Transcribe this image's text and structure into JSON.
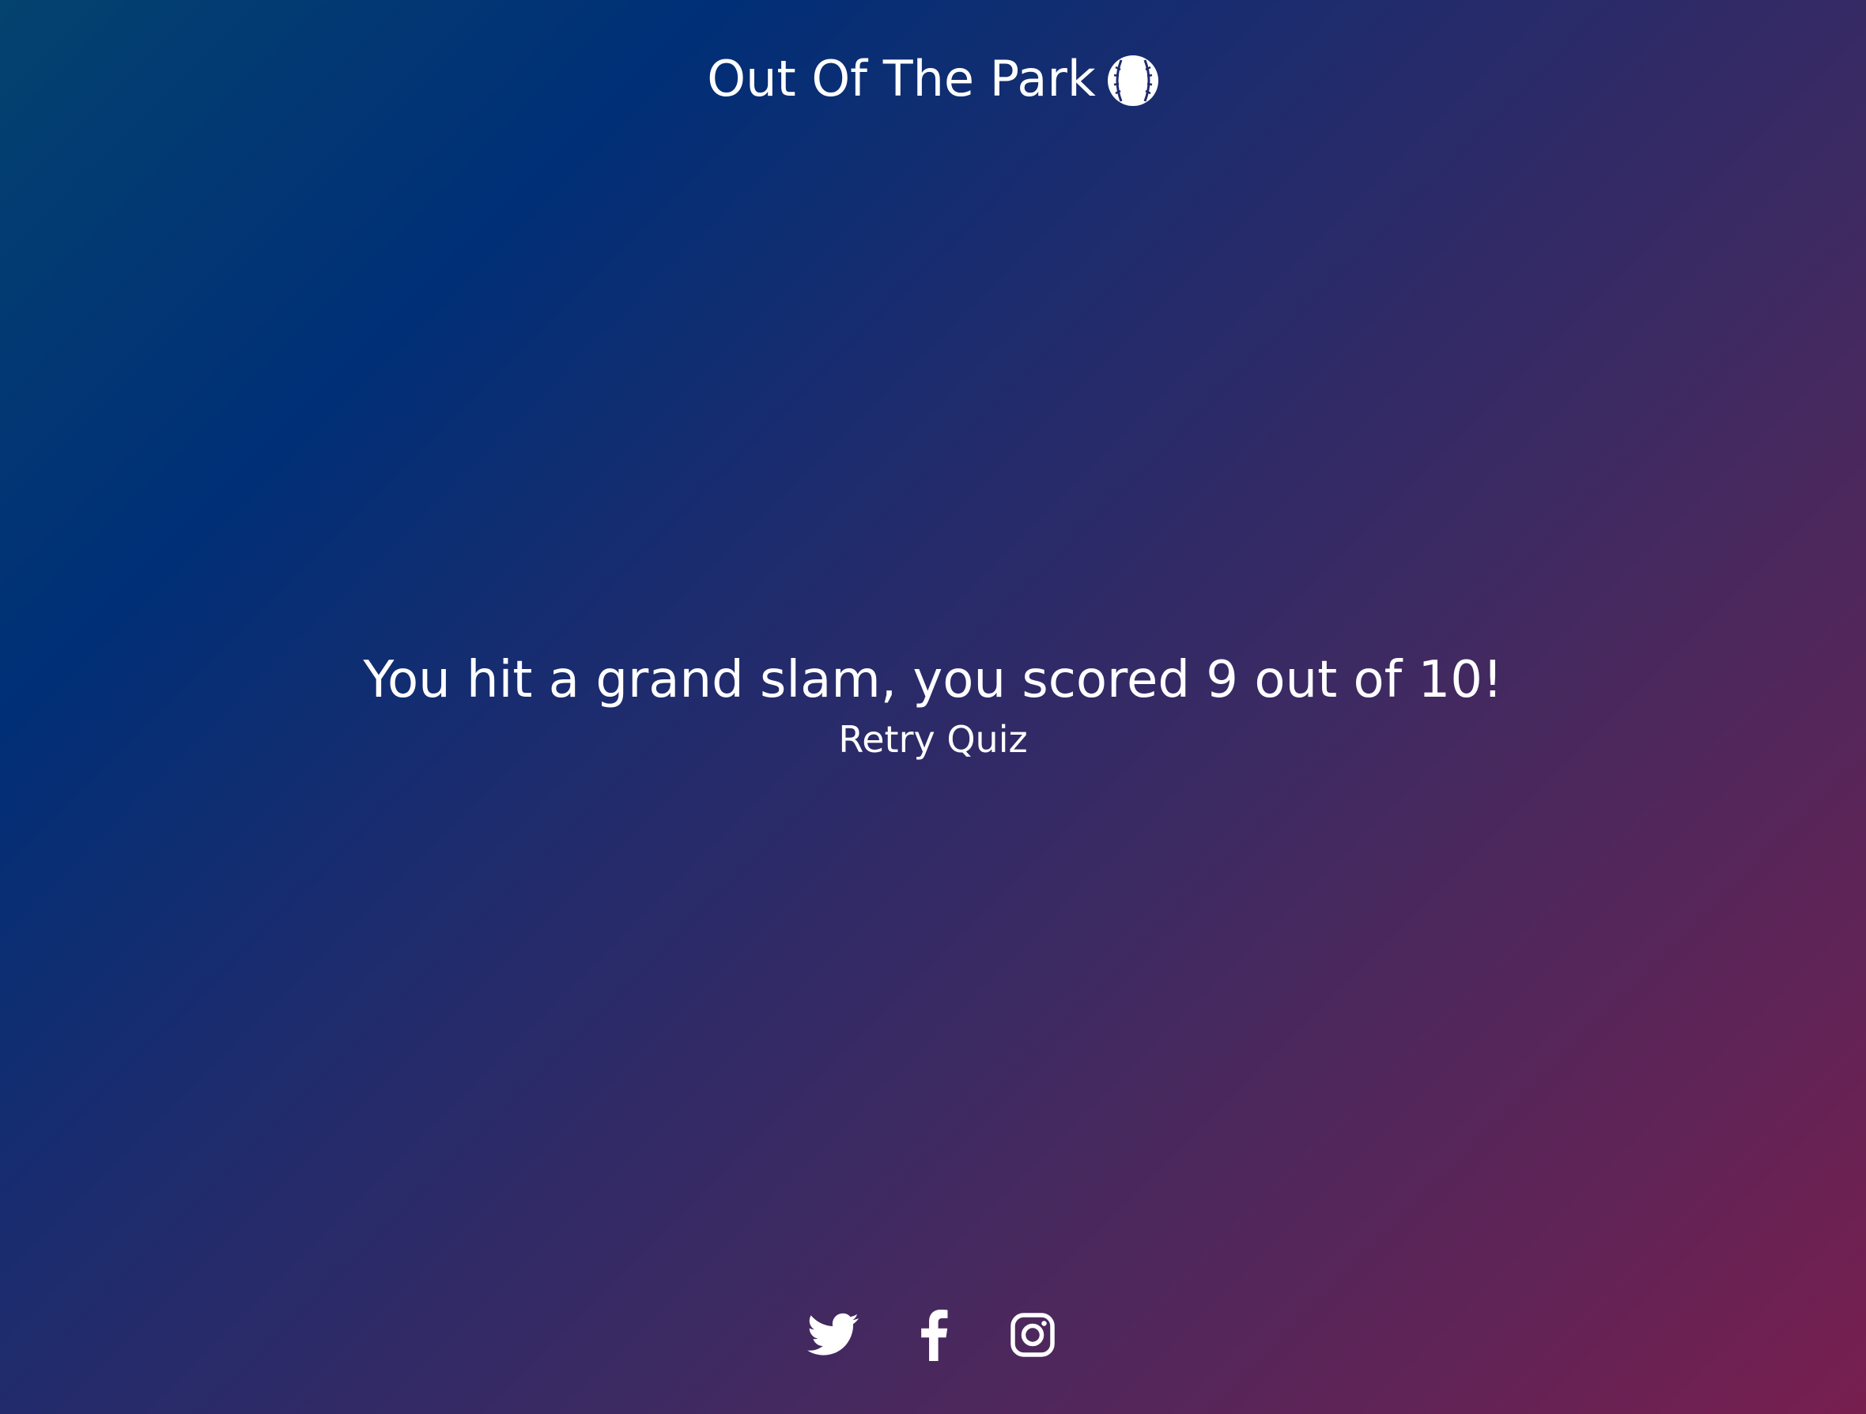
{
  "header": {
    "title": "Out Of The Park",
    "icon": "baseball-icon"
  },
  "result": {
    "message": "You hit a grand slam, you scored 9 out of 10!",
    "retry_label": "Retry Quiz"
  },
  "footer": {
    "social_icons": [
      "twitter-icon",
      "facebook-icon",
      "instagram-icon"
    ]
  },
  "colors": {
    "gradient_start": "#04426f",
    "gradient_mid": "#252b6b",
    "gradient_end": "#771f4f",
    "text": "#ffffff"
  }
}
